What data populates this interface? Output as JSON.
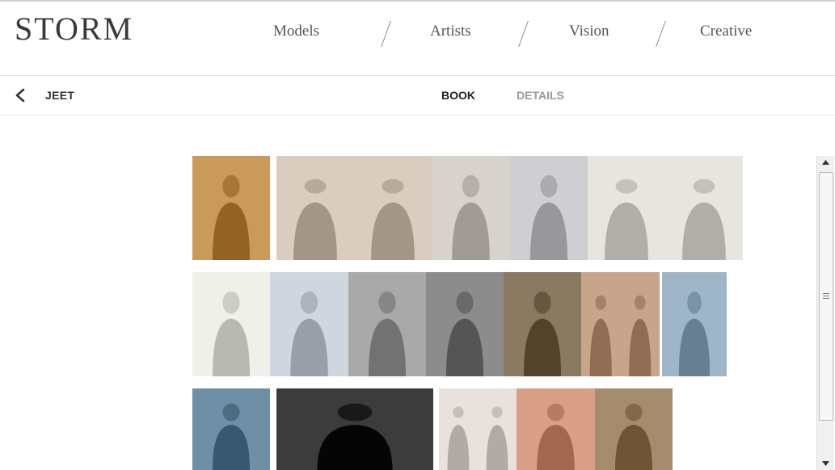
{
  "brand": {
    "logo_text": "STORM"
  },
  "nav": {
    "items": [
      {
        "label": "Models"
      },
      {
        "label": "Artists"
      },
      {
        "label": "Vision"
      },
      {
        "label": "Creative"
      }
    ]
  },
  "subbar": {
    "model_name": "JEET",
    "tabs": [
      {
        "label": "BOOK",
        "active": true
      },
      {
        "label": "DETAILS",
        "active": false
      }
    ]
  },
  "colors": {
    "accent_active": "#222222",
    "inactive_tab": "#9a9a9a",
    "nav_text": "#555555"
  },
  "gallery": {
    "rows": [
      {
        "photos": [
          {
            "tone": "#c99a5a",
            "kind": "portrait"
          },
          {
            "tone": "#d9cdbf",
            "kind": "double"
          },
          {
            "tone": "#d8d2cc",
            "kind": "portrait"
          },
          {
            "tone": "#cfcfd2",
            "kind": "portrait"
          },
          {
            "tone": "#e7e5df",
            "kind": "double"
          }
        ]
      },
      {
        "photos": [
          {
            "tone": "#f0f0ea",
            "kind": "portrait"
          },
          {
            "tone": "#cfd6df",
            "kind": "portrait"
          },
          {
            "tone": "#a9a9a9",
            "kind": "portrait"
          },
          {
            "tone": "#8c8c8c",
            "kind": "portrait"
          },
          {
            "tone": "#8a7a62",
            "kind": "portrait"
          },
          {
            "tone": "#c9a48c",
            "kind": "double"
          },
          {
            "tone": "#9fb6c9",
            "kind": "portrait"
          }
        ]
      },
      {
        "photos": [
          {
            "tone": "#6f8fa6",
            "kind": "portrait"
          },
          {
            "tone": "#3c3c3c",
            "kind": "portrait"
          },
          {
            "tone": "#e9e1dc",
            "kind": "double"
          },
          {
            "tone": "#d89e86",
            "kind": "portrait"
          },
          {
            "tone": "#a58c6e",
            "kind": "portrait"
          }
        ]
      }
    ]
  }
}
